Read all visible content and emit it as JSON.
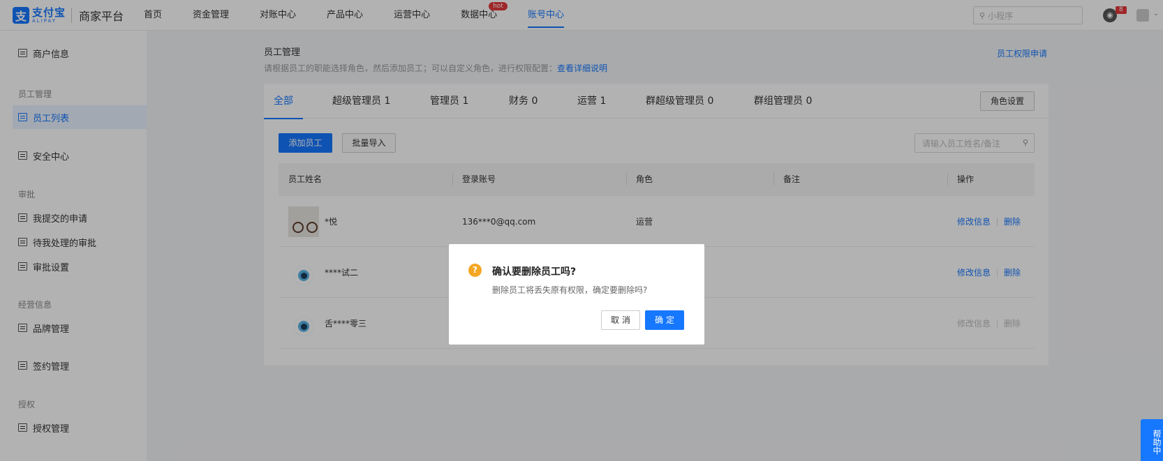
{
  "brand": {
    "logo_mark": "支",
    "name_cn": "支付宝",
    "name_en": "ALIPAY",
    "platform": "商家平台"
  },
  "topnav": {
    "items": [
      "首页",
      "资金管理",
      "对账中心",
      "产品中心",
      "运营中心",
      "数据中心",
      "账号中心"
    ],
    "hot_badge": "hot",
    "search_placeholder": "小程序",
    "notification_count": "8"
  },
  "sidebar": {
    "merchant_info": "商户信息",
    "group_staff": "员工管理",
    "staff_list": "员工列表",
    "security": "安全中心",
    "group_approval": "审批",
    "my_requests": "我提交的申请",
    "pending": "待我处理的审批",
    "approval_settings": "审批设置",
    "group_business": "经营信息",
    "brand_mgmt": "品牌管理",
    "contract_mgmt": "签约管理",
    "group_auth": "授权",
    "auth_mgmt": "授权管理"
  },
  "page": {
    "title": "员工管理",
    "desc": "请根据员工的职能选择角色，然后添加员工；可以自定义角色，进行权限配置：",
    "desc_link": "查看详细说明",
    "perm_link": "员工权限申请"
  },
  "tabs": [
    "全部",
    "超级管理员 1",
    "管理员 1",
    "财务 0",
    "运营 1",
    "群超级管理员 0",
    "群组管理员 0"
  ],
  "role_settings": "角色设置",
  "toolbar": {
    "add": "添加员工",
    "import": "批量导入",
    "search_placeholder": "请输入员工姓名/备注"
  },
  "table": {
    "headers": [
      "员工姓名",
      "登录账号",
      "角色",
      "备注",
      "操作"
    ],
    "rows": [
      {
        "name": "*悦",
        "account": "136***0@qq.com",
        "role": "运营",
        "remark": "",
        "edit": "修改信息",
        "delete": "删除"
      },
      {
        "name": "****试二",
        "account": "",
        "role": "",
        "remark": "",
        "edit": "修改信息",
        "delete": "删除"
      },
      {
        "name": "舌****零三",
        "account": "",
        "role": "",
        "remark": "",
        "edit": "修改信息",
        "delete": "删除"
      }
    ]
  },
  "modal": {
    "icon": "?",
    "title": "确认要删除员工吗?",
    "text": "删除员工将丢失原有权限，确定要删除吗?",
    "cancel": "取消",
    "ok": "确定"
  },
  "help": "帮助中",
  "colors": {
    "primary": "#1677ff",
    "warning": "#f5a623",
    "badge": "#e4393c"
  }
}
